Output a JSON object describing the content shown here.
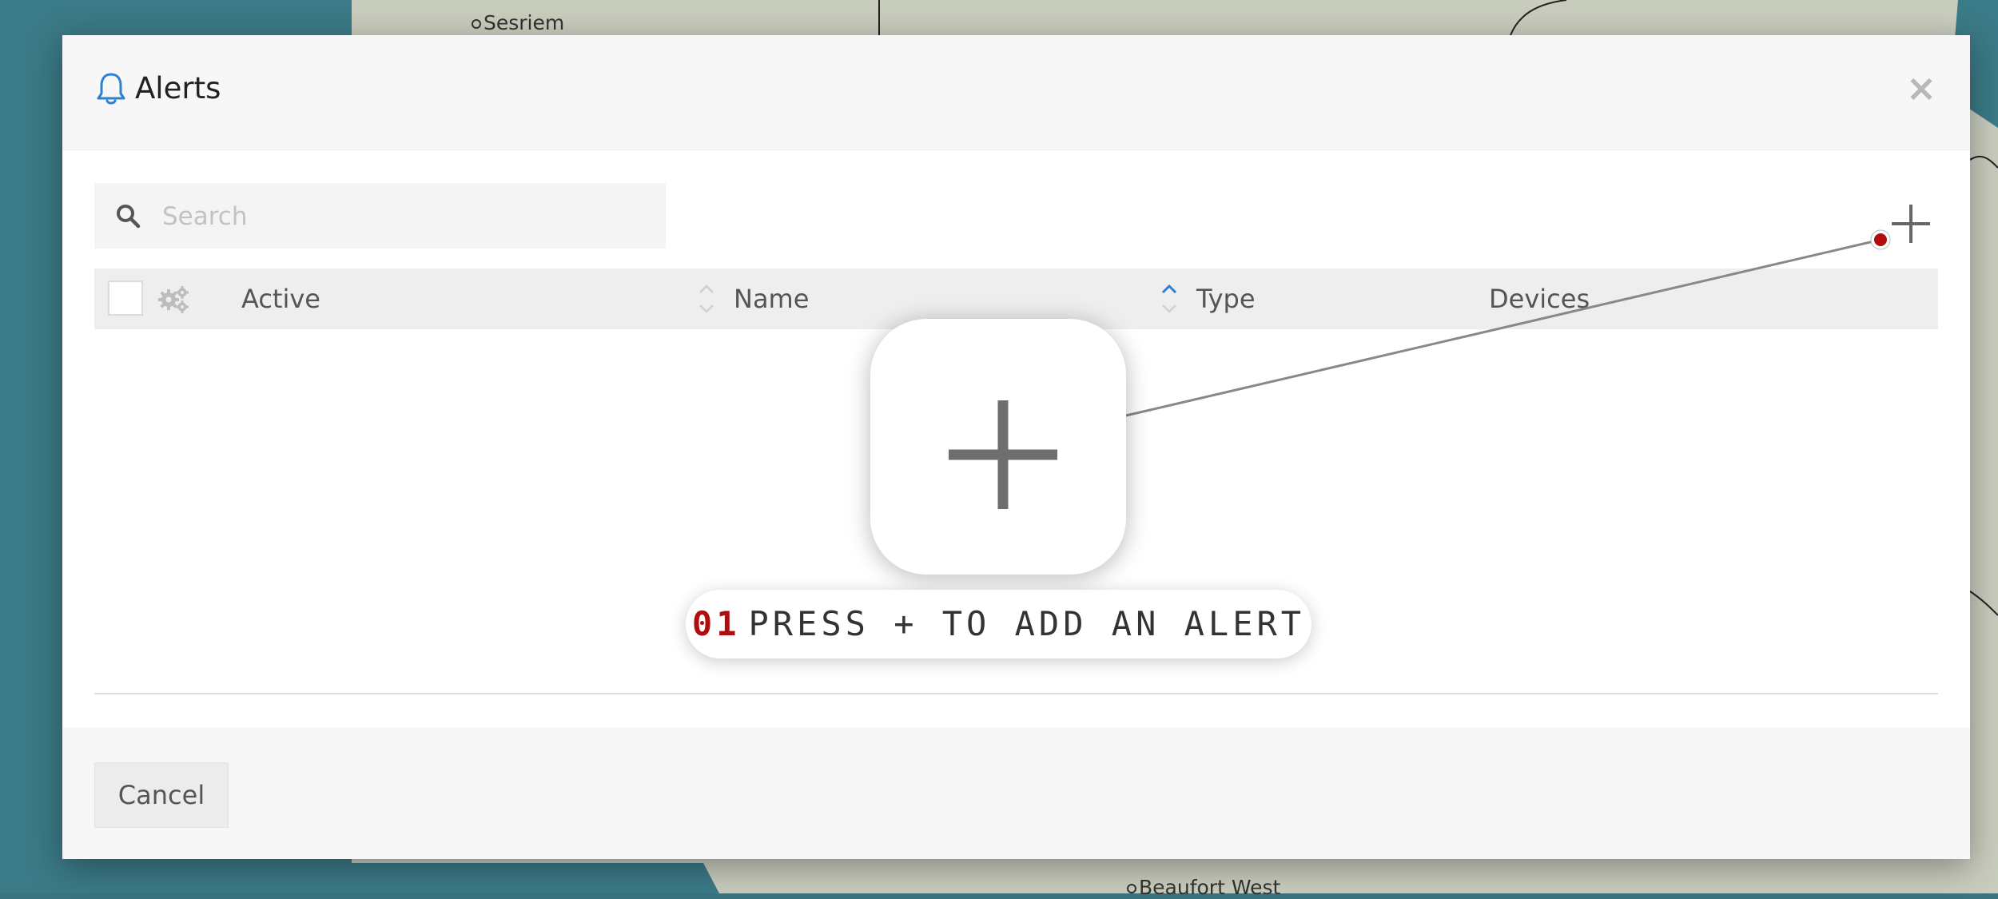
{
  "map": {
    "labels": [
      "Sesriem",
      "Beaufort West"
    ]
  },
  "dialog": {
    "title": "Alerts",
    "close_label": "×"
  },
  "search": {
    "placeholder": "Search",
    "value": ""
  },
  "table": {
    "columns": [
      "Active",
      "Name",
      "Type",
      "Devices"
    ]
  },
  "footer": {
    "cancel_label": "Cancel"
  },
  "tutorial": {
    "step_number": "01",
    "instruction": "PRESS + TO ADD AN ALERT"
  },
  "colors": {
    "accent_blue": "#2f7fd3",
    "tutorial_red": "#b00d0d"
  },
  "icons": [
    "bell-icon",
    "close-icon",
    "search-icon",
    "add-icon",
    "gears-icon",
    "sort-icon"
  ]
}
